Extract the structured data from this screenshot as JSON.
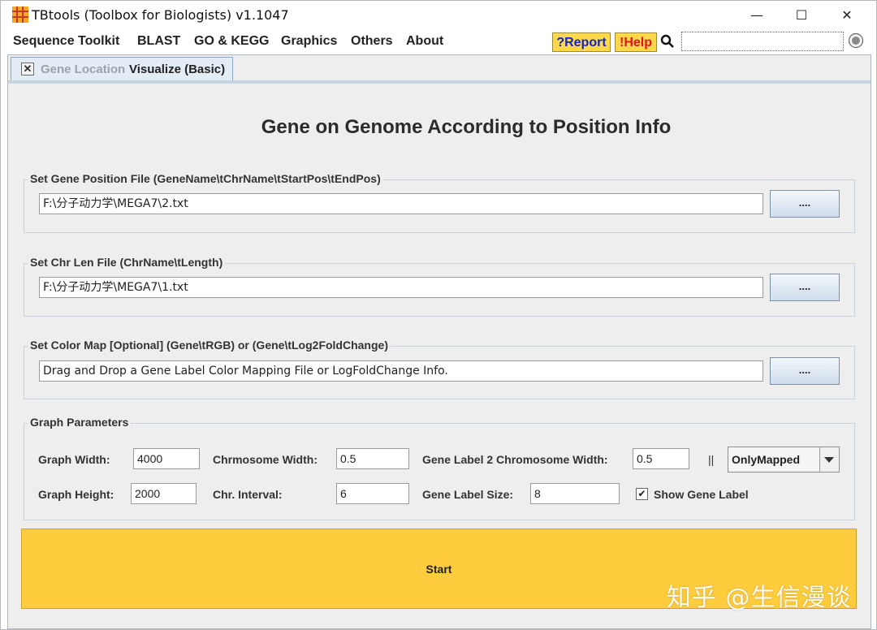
{
  "window": {
    "title": "TBtools (Toolbox for Biologists) v1.1047",
    "controls": {
      "minimize": "—",
      "maximize": "☐",
      "close": "✕"
    }
  },
  "menu": {
    "items": [
      "Sequence Toolkit",
      "BLAST",
      "GO & KEGG",
      "Graphics",
      "Others",
      "About"
    ],
    "report_label": "?Report",
    "help_label": "!Help",
    "search_value": ""
  },
  "tab": {
    "close_glyph": "✕",
    "label_part1": "Gene Location",
    "label_part2": "Visualize (Basic)"
  },
  "page": {
    "title": "Gene on Genome According to Position Info"
  },
  "gene_position": {
    "label": "Set Gene Position File (GeneName\\tChrName\\tStartPos\\tEndPos)",
    "value": "F:\\分子动力学\\MEGA7\\2.txt",
    "browse": "...."
  },
  "chr_len": {
    "label": "Set Chr Len File (ChrName\\tLength)",
    "value": "F:\\分子动力学\\MEGA7\\1.txt",
    "browse": "...."
  },
  "color_map": {
    "label": "Set Color Map [Optional] (Gene\\tRGB) or (Gene\\tLog2FoldChange)",
    "value": "Drag and Drop a Gene Label Color Mapping File or LogFoldChange Info.",
    "browse": "...."
  },
  "params": {
    "group_label": "Graph Parameters",
    "graph_width_label": "Graph Width:",
    "graph_width": "4000",
    "chr_width_label": "Chrmosome Width:",
    "chr_width": "0.5",
    "gene_label_ratio_label": "Gene Label 2 Chromosome Width:",
    "gene_label_ratio": "0.5",
    "separator": "||",
    "mode_selected": "OnlyMapped",
    "graph_height_label": "Graph Height:",
    "graph_height": "2000",
    "chr_interval_label": "Chr. Interval:",
    "chr_interval": "6",
    "gene_label_size_label": "Gene Label Size:",
    "gene_label_size": "8",
    "show_gene_label_checked": "✔",
    "show_gene_label": "Show Gene Label"
  },
  "start_label": "Start",
  "watermark": "知乎 @生信漫谈",
  "colors": {
    "accent_yellow": "#ffcc3d",
    "report_blue": "#1323c7",
    "help_red": "#e0141b"
  }
}
